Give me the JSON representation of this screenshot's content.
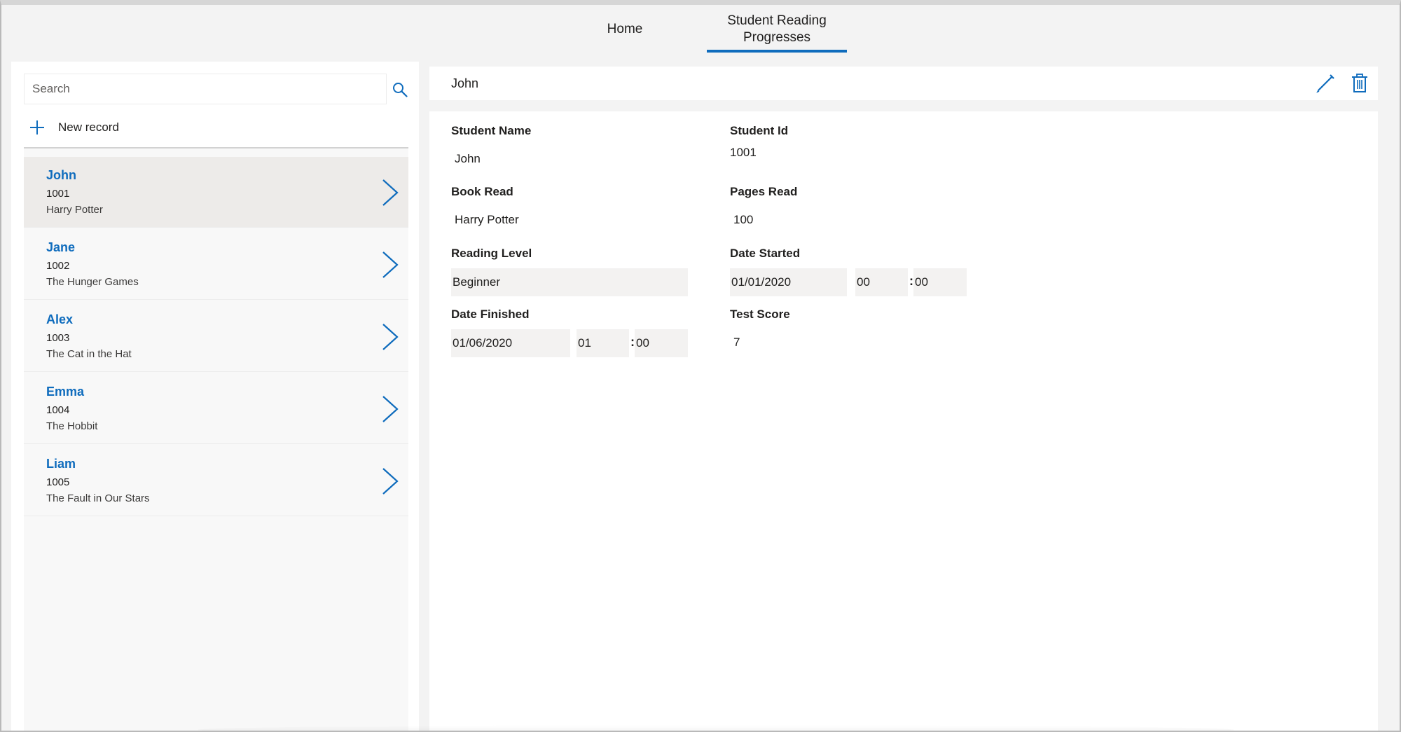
{
  "nav": {
    "tabs": [
      {
        "label": "Home"
      },
      {
        "label": "Student Reading Progresses"
      }
    ],
    "active_tab_color": "#0f6cbd"
  },
  "list": {
    "search_placeholder": "Search",
    "new_record_label": "New record",
    "records": [
      {
        "name": "John",
        "id": "1001",
        "book": "Harry Potter",
        "selected": true
      },
      {
        "name": "Jane",
        "id": "1002",
        "book": "The Hunger Games",
        "selected": false
      },
      {
        "name": "Alex",
        "id": "1003",
        "book": "The Cat in the Hat",
        "selected": false
      },
      {
        "name": "Emma",
        "id": "1004",
        "book": "The Hobbit",
        "selected": false
      },
      {
        "name": "Liam",
        "id": "1005",
        "book": "The Fault in Our Stars",
        "selected": false
      }
    ]
  },
  "detail": {
    "title": "John",
    "fields": {
      "student_name_label": "Student Name",
      "student_name_value": "John",
      "student_id_label": "Student Id",
      "student_id_value": "1001",
      "book_read_label": "Book Read",
      "book_read_value": "Harry Potter",
      "pages_read_label": "Pages Read",
      "pages_read_value": "100",
      "reading_level_label": "Reading Level",
      "reading_level_value": "Beginner",
      "date_started_label": "Date Started",
      "date_started_date": "01/01/2020",
      "date_started_hour": "00",
      "date_started_minute": "00",
      "date_finished_label": "Date Finished",
      "date_finished_date": "01/06/2020",
      "date_finished_hour": "01",
      "date_finished_minute": "00",
      "test_score_label": "Test Score",
      "test_score_value": "7",
      "time_separator": ":"
    }
  },
  "icons": {
    "search": "search-icon",
    "add": "plus-icon",
    "chevron": "chevron-right-icon",
    "edit": "pencil-icon",
    "delete": "trash-icon"
  },
  "colors": {
    "accent": "#0f6cbd",
    "selected_row": "#edebe9",
    "input_bg": "#f3f2f1"
  }
}
